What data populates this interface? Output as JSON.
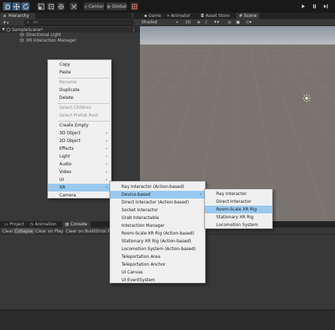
{
  "toolbar": {
    "tools": [
      {
        "icon": "hand-tool-icon"
      },
      {
        "icon": "move-tool-icon"
      },
      {
        "icon": "rotate-tool-icon"
      },
      {
        "icon": "scale-tool-icon"
      },
      {
        "icon": "rect-tool-icon"
      },
      {
        "icon": "transform-tool-icon"
      },
      {
        "icon": "custom-tool-icon"
      }
    ],
    "pivot_label": "Center",
    "space_label": "Global",
    "play_icon": "play-icon",
    "pause_icon": "pause-icon",
    "step_icon": "step-icon"
  },
  "hierarchy": {
    "tab_label": "Hierarchy",
    "search_placeholder": "All",
    "scene_name": "SampleScene*",
    "objects": [
      "Directional Light",
      "XR Interaction Manager"
    ]
  },
  "scene_panel": {
    "tabs": [
      "Game",
      "Animator",
      "Asset Store",
      "Scene"
    ],
    "active_tab": "Scene",
    "shading_mode": "Shaded",
    "mode_2d": "2D",
    "colors": {
      "sky": "#8f97a3",
      "horizon": "#b9bdc2",
      "ground": "#7a7470",
      "grid": "#8a8480"
    }
  },
  "bottom_panel": {
    "tabs": [
      "Project",
      "Animation",
      "Console"
    ],
    "active_tab": "Console",
    "console_buttons": [
      "Clear",
      "Collapse",
      "Clear on Play",
      "Clear on Build",
      "Error Pa"
    ]
  },
  "context_menu": {
    "groups": [
      [
        {
          "label": "Copy",
          "enabled": true
        },
        {
          "label": "Paste",
          "enabled": true
        }
      ],
      [
        {
          "label": "Rename",
          "enabled": false
        },
        {
          "label": "Duplicate",
          "enabled": true
        },
        {
          "label": "Delete",
          "enabled": true
        }
      ],
      [
        {
          "label": "Select Children",
          "enabled": false
        },
        {
          "label": "Select Prefab Root",
          "enabled": false
        }
      ],
      [
        {
          "label": "Create Empty",
          "enabled": true
        },
        {
          "label": "3D Object",
          "enabled": true,
          "submenu": true
        },
        {
          "label": "2D Object",
          "enabled": true,
          "submenu": true
        },
        {
          "label": "Effects",
          "enabled": true,
          "submenu": true
        },
        {
          "label": "Light",
          "enabled": true,
          "submenu": true
        },
        {
          "label": "Audio",
          "enabled": true,
          "submenu": true
        },
        {
          "label": "Video",
          "enabled": true,
          "submenu": true
        },
        {
          "label": "UI",
          "enabled": true,
          "submenu": true
        },
        {
          "label": "XR",
          "enabled": true,
          "submenu": true,
          "highlighted": true
        },
        {
          "label": "Camera",
          "enabled": true
        }
      ]
    ]
  },
  "xr_menu": {
    "items": [
      {
        "label": "Ray Interactor (Action-based)"
      },
      {
        "label": "Device-based",
        "submenu": true,
        "highlighted": true
      },
      {
        "label": "Direct Interactor (Action-based)"
      },
      {
        "label": "Socket Interactor"
      },
      {
        "label": "Grab Interactable"
      },
      {
        "label": "Interaction Manager"
      },
      {
        "label": "Room-Scale XR Rig (Action-based)"
      },
      {
        "label": "Stationary XR Rig (Action-based)"
      },
      {
        "label": "Locomotion System (Action-based)"
      },
      {
        "label": "Teleportation Area"
      },
      {
        "label": "Teleportation Anchor"
      },
      {
        "label": "UI Canvas"
      },
      {
        "label": "UI EventSystem"
      }
    ]
  },
  "device_menu": {
    "items": [
      {
        "label": "Ray Interactor"
      },
      {
        "label": "Direct Interactor"
      },
      {
        "label": "Room-Scale XR Rig",
        "highlighted": true
      },
      {
        "label": "Stationary XR Rig"
      },
      {
        "label": "Locomotion System"
      }
    ]
  },
  "colors": {
    "menu_bg": "#f0f0f0",
    "menu_highlight": "#99c9ef",
    "editor_bg": "#383838",
    "toolbar_active": "#46607c"
  }
}
